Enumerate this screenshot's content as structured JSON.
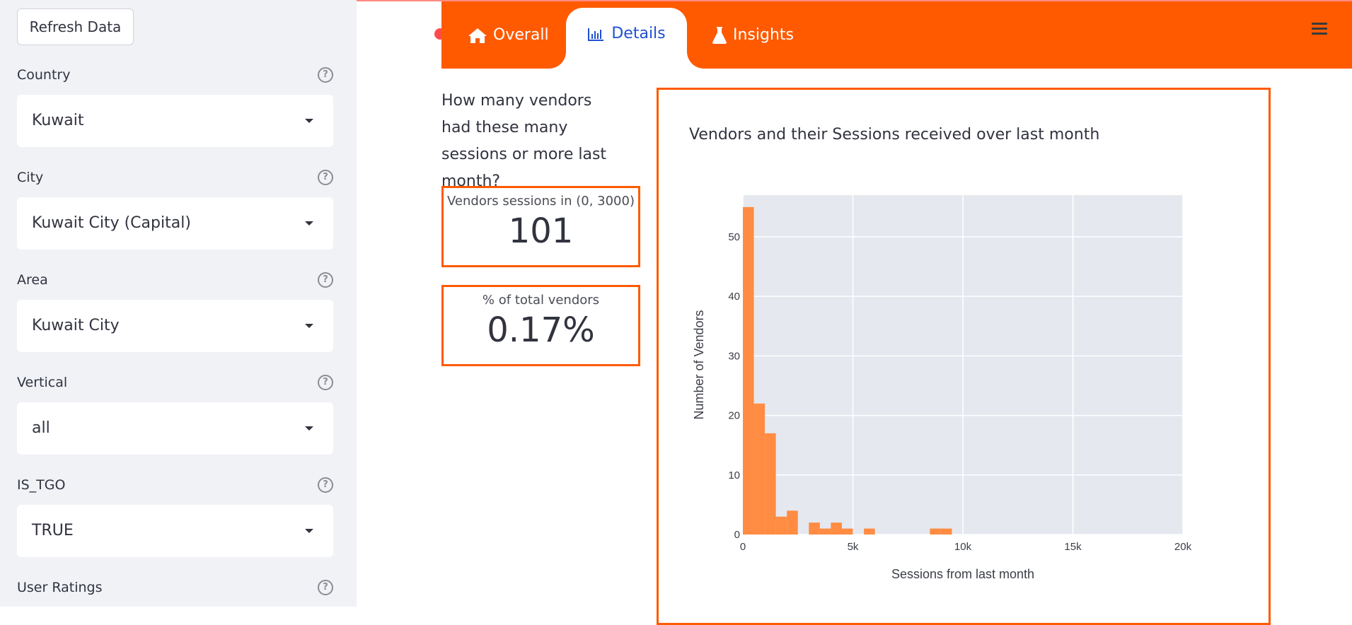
{
  "sidebar": {
    "refresh_label": "Refresh Data",
    "fields": [
      {
        "label": "Country",
        "value": "Kuwait"
      },
      {
        "label": "City",
        "value": "Kuwait City (Capital)"
      },
      {
        "label": "Area",
        "value": "Kuwait City"
      },
      {
        "label": "Vertical",
        "value": "all"
      },
      {
        "label": "IS_TGO",
        "value": "TRUE"
      },
      {
        "label": "User Ratings",
        "value": ""
      }
    ],
    "help_glyph": "?"
  },
  "tabs": {
    "overall": "Overall",
    "details": "Details",
    "insights": "Insights",
    "active": "Details"
  },
  "main": {
    "question": "How many vendors had these many sessions or more last month?",
    "metrics": [
      {
        "label": "Vendors sessions in (0, 3000)",
        "value": "101"
      },
      {
        "label": "% of total vendors",
        "value": "0.17%"
      }
    ]
  },
  "colors": {
    "accent": "#ff5a00",
    "bar": "#ff8c42",
    "active_tab_text": "#1f4fd4"
  },
  "chart_data": {
    "type": "bar",
    "title": "Vendors and their Sessions received over last month",
    "xlabel": "Sessions from last month",
    "ylabel": "Number of Vendors",
    "xlim": [
      0,
      20000
    ],
    "ylim": [
      0,
      57
    ],
    "xticks": [
      "0",
      "5k",
      "10k",
      "15k",
      "20k"
    ],
    "yticks": [
      "0",
      "10",
      "20",
      "30",
      "40",
      "50"
    ],
    "bin_width": 500,
    "bins": [
      {
        "x0": 0,
        "x1": 500,
        "count": 55
      },
      {
        "x0": 500,
        "x1": 1000,
        "count": 22
      },
      {
        "x0": 1000,
        "x1": 1500,
        "count": 17
      },
      {
        "x0": 1500,
        "x1": 2000,
        "count": 3
      },
      {
        "x0": 2000,
        "x1": 2500,
        "count": 4
      },
      {
        "x0": 3000,
        "x1": 3500,
        "count": 2
      },
      {
        "x0": 3500,
        "x1": 4000,
        "count": 1
      },
      {
        "x0": 4000,
        "x1": 4500,
        "count": 2
      },
      {
        "x0": 4500,
        "x1": 5000,
        "count": 1
      },
      {
        "x0": 5500,
        "x1": 6000,
        "count": 1
      },
      {
        "x0": 8500,
        "x1": 9000,
        "count": 1
      },
      {
        "x0": 9000,
        "x1": 9500,
        "count": 1
      }
    ],
    "grid": true
  }
}
